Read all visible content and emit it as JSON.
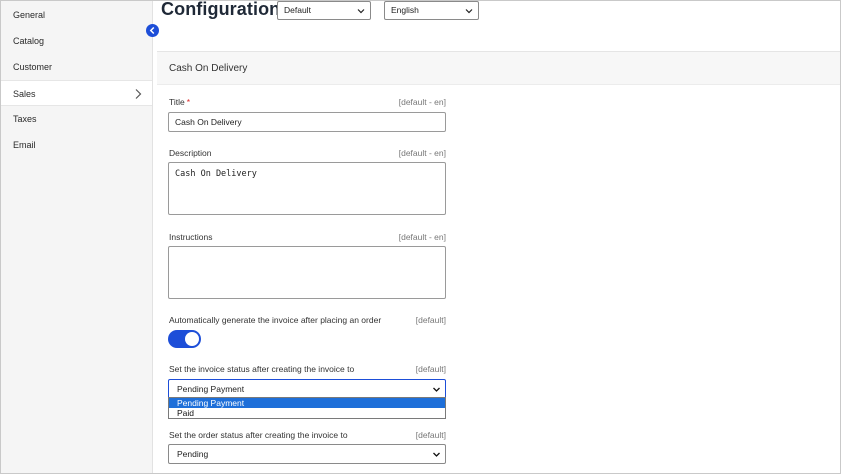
{
  "sidebar": {
    "items": [
      {
        "label": "General"
      },
      {
        "label": "Catalog"
      },
      {
        "label": "Customer"
      },
      {
        "label": "Sales"
      },
      {
        "label": "Taxes"
      },
      {
        "label": "Email"
      }
    ],
    "active_index": 3
  },
  "header": {
    "title": "Configuration",
    "channel": "Default",
    "locale": "English"
  },
  "section": {
    "title": "Cash On Delivery",
    "fields": {
      "title": {
        "label": "Title",
        "required_mark": "*",
        "scope": "[default - en]",
        "value": "Cash On Delivery"
      },
      "description": {
        "label": "Description",
        "scope": "[default - en]",
        "value": "Cash On Delivery"
      },
      "instructions": {
        "label": "Instructions",
        "scope": "[default - en]",
        "value": ""
      },
      "auto_invoice": {
        "label": "Automatically generate the invoice after placing an order",
        "scope": "[default]",
        "enabled": true
      },
      "invoice_status": {
        "label": "Set the invoice status after creating the invoice to",
        "scope": "[default]",
        "value": "Pending Payment",
        "options": [
          "Pending Payment",
          "Paid"
        ]
      },
      "order_status": {
        "label": "Set the order status after creating the invoice to",
        "scope": "[default]",
        "value": "Pending"
      }
    }
  },
  "colors": {
    "accent": "#1d4ed8",
    "highlight": "#1e6fd9",
    "required": "#dc2626"
  }
}
